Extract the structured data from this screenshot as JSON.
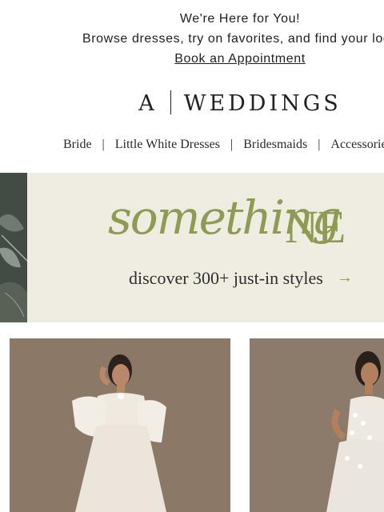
{
  "banner": {
    "line1": "We're Here for You!",
    "line2": "Browse dresses, try on favorites, and find your look",
    "link": "Book an Appointment"
  },
  "logo": {
    "left": "A",
    "right": "WEDDINGS"
  },
  "nav": {
    "items": [
      {
        "label": "Bride"
      },
      {
        "label": "Little White Dresses"
      },
      {
        "label": "Bridesmaids"
      },
      {
        "label": "Accessories"
      }
    ],
    "separator": "|"
  },
  "hero": {
    "script_text": "something",
    "caps_text": "NE",
    "cta": "discover 300+ just-in styles",
    "arrow": "→",
    "accent_color": "#8f9a52"
  },
  "products": [
    {
      "image": "bride-in-off-shoulder-ruffle-gown"
    },
    {
      "image": "bride-in-floral-lace-gown"
    }
  ]
}
